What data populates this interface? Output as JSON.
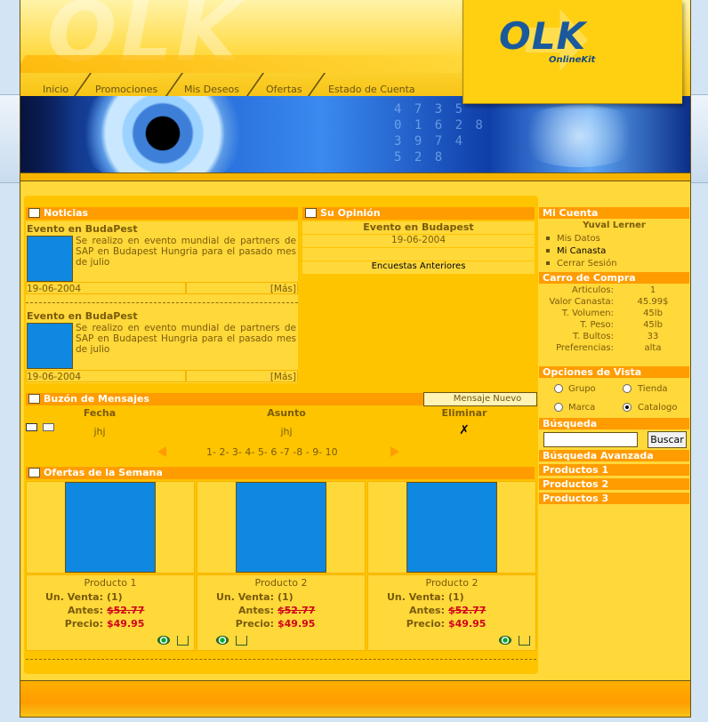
{
  "brand": {
    "logo": "OLK",
    "tagline": "OnlineKit",
    "watermark": "OLK"
  },
  "nav": [
    "Inicio",
    "Promociones",
    "Mis Deseos",
    "Ofertas",
    "Estado de Cuenta"
  ],
  "news": {
    "header": "Noticias",
    "items": [
      {
        "title": "Evento en BudaPest",
        "text": "Se realizo en evento mundial de partners de SAP en Budapest Hungria para el pasado mes de julio",
        "date": "19-06-2004",
        "more": "[Más]"
      },
      {
        "title": "Evento en BudaPest",
        "text": "Se realizo en evento mundial de partners de SAP en Budapest Hungria para el pasado mes de julio",
        "date": "19-06-2004",
        "more": "[Más]"
      }
    ]
  },
  "opinion": {
    "header": "Su Opinión",
    "title": "Evento en Budapest",
    "date": "19-06-2004",
    "past": "Encuestas Anteriores"
  },
  "messages": {
    "header": "Buzón de Mensajes",
    "new_button": "Mensaje Nuevo",
    "columns": {
      "date": "Fecha",
      "subject": "Asunto",
      "delete": "Eliminar"
    },
    "rows": [
      {
        "date": "jhj",
        "subject": "jhj",
        "delete": "✗"
      }
    ],
    "pages": "1- 2- 3- 4- 5- 6 -7 -8 - 9- 10"
  },
  "offers": {
    "header": "Ofertas de la Semana",
    "labels": {
      "unit": "Un. Venta:",
      "before": "Antes:",
      "price": "Precio:"
    },
    "products": [
      {
        "name": "Producto 1",
        "unit": "(1)",
        "before": "$52.77",
        "price": "$49.95"
      },
      {
        "name": "Producto 2",
        "unit": "(1)",
        "before": "$52.77",
        "price": "$49.95"
      },
      {
        "name": "Producto 2",
        "unit": "(1)",
        "before": "$52.77",
        "price": "$49.95"
      }
    ]
  },
  "account": {
    "header": "Mi Cuenta",
    "user": "Yuval Lerner",
    "links": [
      "Mis Datos",
      "Mi Canasta",
      "Cerrar Sesión"
    ]
  },
  "cart": {
    "header": "Carro de Compra",
    "rows": [
      {
        "label": "Articulos:",
        "value": "1"
      },
      {
        "label": "Valor Canasta:",
        "value": "45.99$"
      },
      {
        "label": "T. Volumen:",
        "value": "45lb"
      },
      {
        "label": "T. Peso:",
        "value": "45lb"
      },
      {
        "label": "T. Bultos:",
        "value": "33"
      },
      {
        "label": "Preferencias:",
        "value": "alta"
      }
    ]
  },
  "view": {
    "header": "Opciones de Vista",
    "options": [
      {
        "label": "Grupo",
        "selected": false
      },
      {
        "label": "Tienda",
        "selected": false
      },
      {
        "label": "Marca",
        "selected": false
      },
      {
        "label": "Catalogo",
        "selected": true
      }
    ]
  },
  "search": {
    "header": "Búsqueda",
    "value": "",
    "button": "Buscar"
  },
  "side_links": [
    "Búsqueda Avanzada",
    "Productos 1",
    "Productos 2",
    "Productos 3"
  ],
  "colors": {
    "accent": "#ff9c00",
    "panel": "#ffd83a",
    "product": "#0e88e0",
    "price": "#d0021b"
  }
}
